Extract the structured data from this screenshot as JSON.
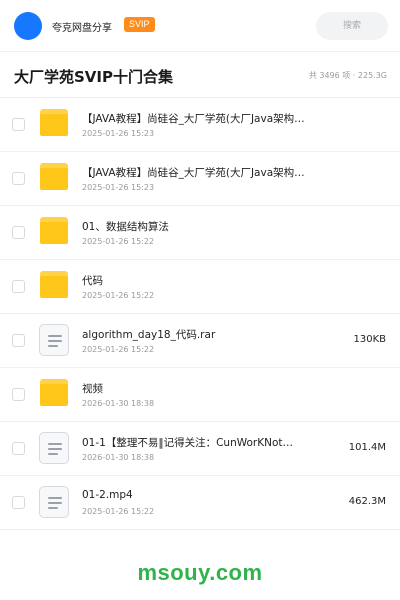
{
  "header": {
    "brand": "夸克网盘分享",
    "vip_badge": "SVIP",
    "search_placeholder": "搜索"
  },
  "page": {
    "title": "大厂学苑SVIP十门合集",
    "summary": "共 3496 项 · 225.3G"
  },
  "files": [
    {
      "type": "folder",
      "name": "【JAVA教程】尚硅谷_大厂学苑(大厂Java架构…",
      "date": "2025-01-26 15:23",
      "size": ""
    },
    {
      "type": "folder",
      "name": "【JAVA教程】尚硅谷_大厂学苑(大厂Java架构…",
      "date": "2025-01-26 15:23",
      "size": ""
    },
    {
      "type": "folder",
      "name": "01、数据结构算法",
      "date": "2025-01-26 15:22",
      "size": ""
    },
    {
      "type": "folder",
      "name": "代码",
      "date": "2025-01-26 15:22",
      "size": ""
    },
    {
      "type": "file",
      "name": "algorithm_day18_代码.rar",
      "date": "2025-01-26 15:22",
      "size": "130KB"
    },
    {
      "type": "folder",
      "name": "视频",
      "date": "2026-01-30 18:38",
      "size": ""
    },
    {
      "type": "file",
      "name": "01-1【整理不易‖记得关注：CunWorKNot…",
      "date": "2026-01-30 18:38",
      "size": "101.4M"
    },
    {
      "type": "file",
      "name": "01-2.mp4",
      "date": "2025-01-26 15:22",
      "size": "462.3M"
    }
  ],
  "footer": {
    "watermark": "msouy.com"
  },
  "colors": {
    "accent_blue": "#1677ff",
    "vip_orange": "#ff8c1a",
    "folder_yellow": "#ffc61a",
    "watermark_green": "#2fb34a"
  }
}
